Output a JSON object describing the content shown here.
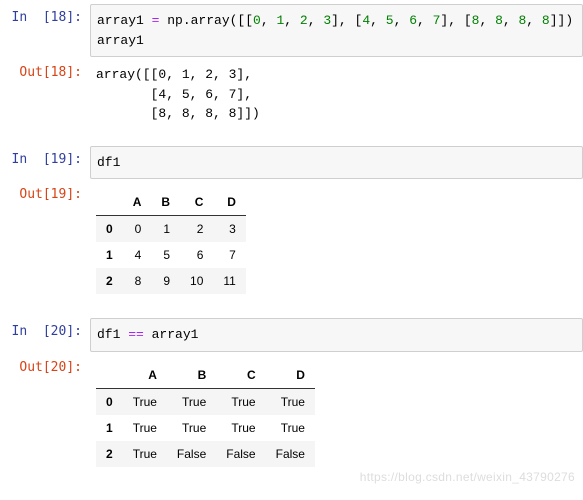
{
  "cells": {
    "c18": {
      "in_prompt": "In  [18]:",
      "out_prompt": "Out[18]:",
      "code_prefix": "array1 ",
      "code_eq": "=",
      "code_call": " np.array([[",
      "nums_row1": [
        "0",
        "1",
        "2",
        "3"
      ],
      "nums_row2": [
        "4",
        "5",
        "6",
        "7"
      ],
      "nums_row3": [
        "8",
        "8",
        "8",
        "8"
      ],
      "code_suffix": "]])",
      "code_line2": "array1",
      "output": "array([[0, 1, 2, 3],\n       [4, 5, 6, 7],\n       [8, 8, 8, 8]])"
    },
    "c19": {
      "in_prompt": "In  [19]:",
      "out_prompt": "Out[19]:",
      "code": "df1",
      "df": {
        "columns": [
          "A",
          "B",
          "C",
          "D"
        ],
        "index": [
          "0",
          "1",
          "2"
        ],
        "rows": [
          [
            "0",
            "1",
            "2",
            "3"
          ],
          [
            "4",
            "5",
            "6",
            "7"
          ],
          [
            "8",
            "9",
            "10",
            "11"
          ]
        ]
      }
    },
    "c20": {
      "in_prompt": "In  [20]:",
      "out_prompt": "Out[20]:",
      "code_var": "df1 ",
      "code_op": "==",
      "code_var2": " array1",
      "df": {
        "columns": [
          "A",
          "B",
          "C",
          "D"
        ],
        "index": [
          "0",
          "1",
          "2"
        ],
        "rows": [
          [
            "True",
            "True",
            "True",
            "True"
          ],
          [
            "True",
            "True",
            "True",
            "True"
          ],
          [
            "True",
            "False",
            "False",
            "False"
          ]
        ]
      }
    }
  },
  "watermark": "https://blog.csdn.net/weixin_43790276",
  "chart_data": [
    {
      "type": "table",
      "title": "df1",
      "columns": [
        "A",
        "B",
        "C",
        "D"
      ],
      "index": [
        0,
        1,
        2
      ],
      "values": [
        [
          0,
          1,
          2,
          3
        ],
        [
          4,
          5,
          6,
          7
        ],
        [
          8,
          9,
          10,
          11
        ]
      ]
    },
    {
      "type": "table",
      "title": "df1 == array1",
      "columns": [
        "A",
        "B",
        "C",
        "D"
      ],
      "index": [
        0,
        1,
        2
      ],
      "values": [
        [
          true,
          true,
          true,
          true
        ],
        [
          true,
          true,
          true,
          true
        ],
        [
          true,
          false,
          false,
          false
        ]
      ]
    }
  ]
}
